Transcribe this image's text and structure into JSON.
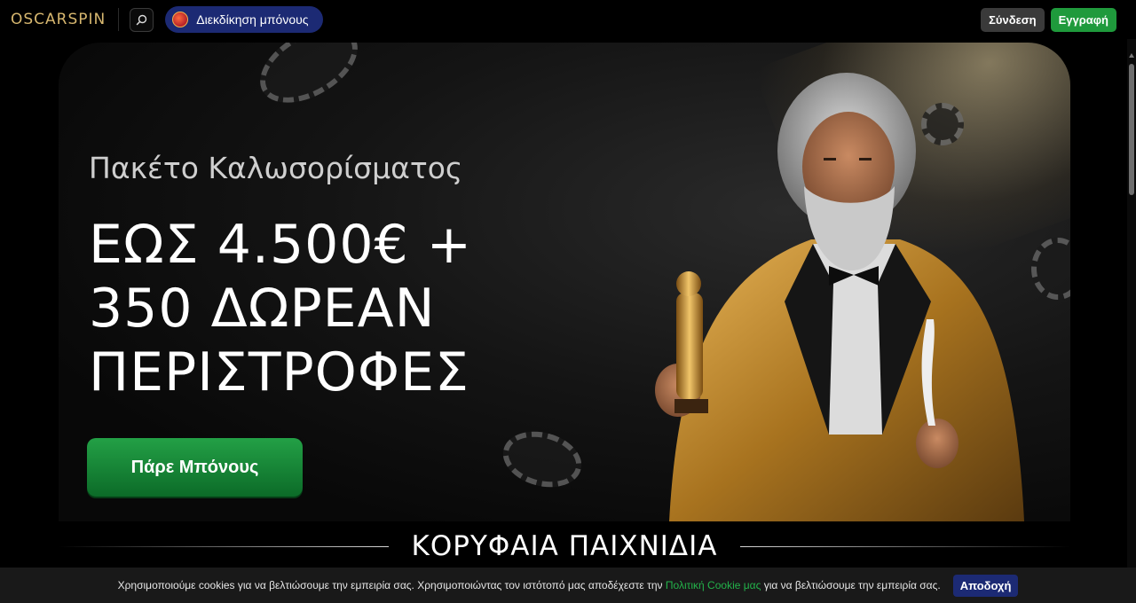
{
  "header": {
    "logo_text": "OSCARSPIN",
    "search_icon": "search-icon",
    "claim_bonus_label": "Διεκδίκηση μπόνους",
    "login_label": "Σύνδεση",
    "register_label": "Εγγραφή"
  },
  "hero": {
    "subtitle": "Πακέτο Καλωσορίσματος",
    "title_lines": [
      "ΕΩΣ 4.500€ +",
      "350 ΔΩΡΕΑΝ",
      "ΠΕΡΙΣΤΡΟΦΕΣ"
    ],
    "cta_label": "Πάρε Μπόνους"
  },
  "section": {
    "title": "ΚΟΡΥΦΑΙΑ ΠΑΙΧΝΙΔΙΑ"
  },
  "cookie": {
    "text_before": "Χρησιμοποιούμε cookies για να βελτιώσουμε την εμπειρία σας. Χρησιμοποιώντας τον ιστότοπό μας αποδέχεστε την ",
    "link_text": "Πολιτική Cookie μας",
    "text_after": " για να βελτιώσουμε την εμπειρία σας.",
    "accept_label": "Αποδοχή"
  },
  "colors": {
    "brand_gold": "#d7b76f",
    "cta_green": "#1f9a3c",
    "claim_blue": "#1c2a74"
  }
}
